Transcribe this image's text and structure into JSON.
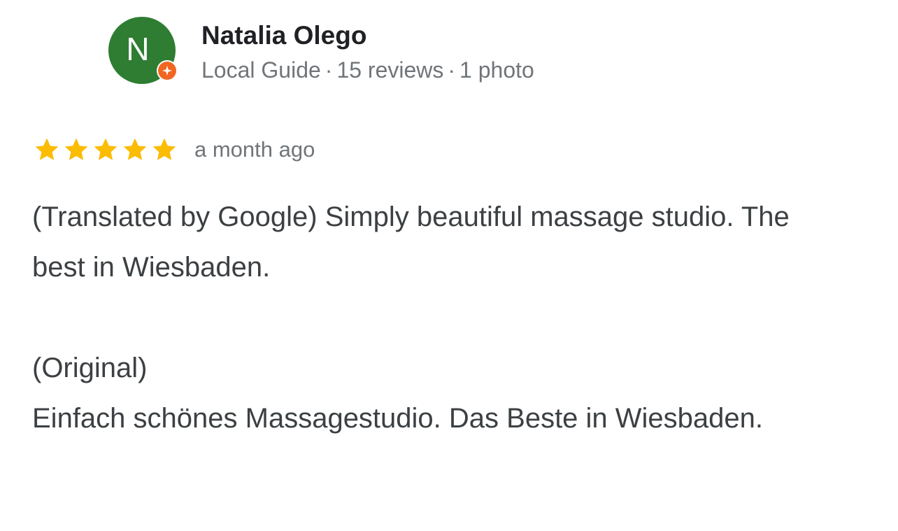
{
  "reviewer": {
    "avatar_letter": "N",
    "avatar_color": "#2e7d32",
    "badge_color": "#f16722",
    "badge_icon": "local-guide-star-icon",
    "name": "Natalia Olego",
    "level": "Local Guide",
    "separator": "·",
    "reviews_count": "15 reviews",
    "photos_count": "1 photo"
  },
  "rating": {
    "stars": 5,
    "max_stars": 5,
    "star_color": "#fbbc04",
    "date": "a month ago"
  },
  "review": {
    "translated_text": "(Translated by Google) Simply beautiful massage studio. The best in Wiesbaden.",
    "original_label": "(Original)",
    "original_text": "Einfach schönes Massagestudio. Das Beste in Wiesbaden."
  }
}
